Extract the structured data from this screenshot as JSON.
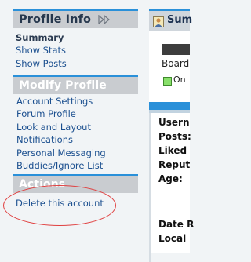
{
  "sidebar": {
    "profile_info": {
      "title": "Profile Info",
      "items": [
        {
          "label": "Summary"
        },
        {
          "label": "Show Stats"
        },
        {
          "label": "Show Posts"
        }
      ]
    },
    "modify_profile": {
      "title": "Modify Profile",
      "items": [
        {
          "label": "Account Settings"
        },
        {
          "label": "Forum Profile"
        },
        {
          "label": "Look and Layout"
        },
        {
          "label": "Notifications"
        },
        {
          "label": "Personal Messaging"
        },
        {
          "label": "Buddies/Ignore List"
        }
      ]
    },
    "actions": {
      "title": "Actions",
      "items": [
        {
          "label": "Delete this account"
        }
      ]
    }
  },
  "right_panel": {
    "header_title": "Sum",
    "board_text": "Board",
    "online_text": "On",
    "labels": [
      "Usern",
      "Posts:",
      "Liked",
      "Reput",
      "Age:",
      "Date R",
      "Local"
    ]
  },
  "colors": {
    "accent_blue": "#2a90d9",
    "link": "#1b4f8f",
    "highlight_circle": "#e04040"
  }
}
